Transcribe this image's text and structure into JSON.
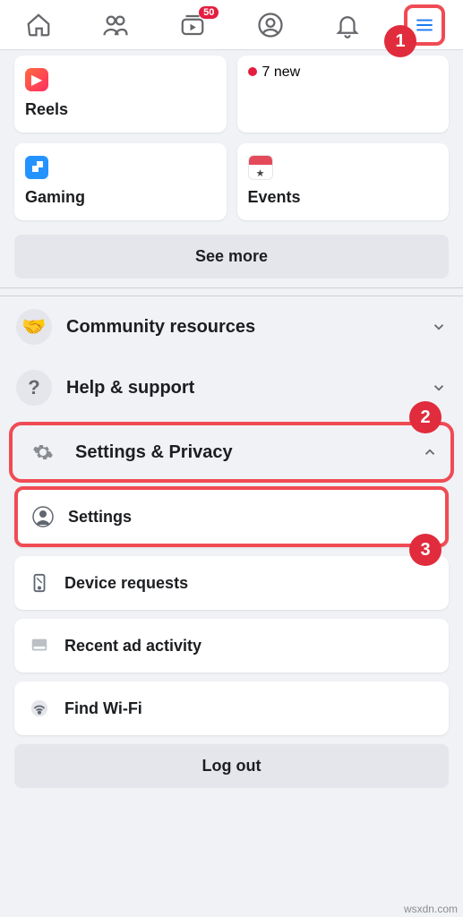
{
  "topbar": {
    "badge": "50"
  },
  "steps": {
    "s1": "1",
    "s2": "2",
    "s3": "3"
  },
  "tiles": {
    "newcount": "7 new",
    "reels": "Reels",
    "gaming": "Gaming",
    "events": "Events"
  },
  "seemore": "See more",
  "sections": {
    "community": "Community resources",
    "help": "Help & support",
    "settings_privacy": "Settings & Privacy"
  },
  "sub": {
    "settings": "Settings",
    "device": "Device requests",
    "recent_ad": "Recent ad activity",
    "wifi": "Find Wi-Fi"
  },
  "logout": "Log out",
  "watermark": "wsxdn.com"
}
